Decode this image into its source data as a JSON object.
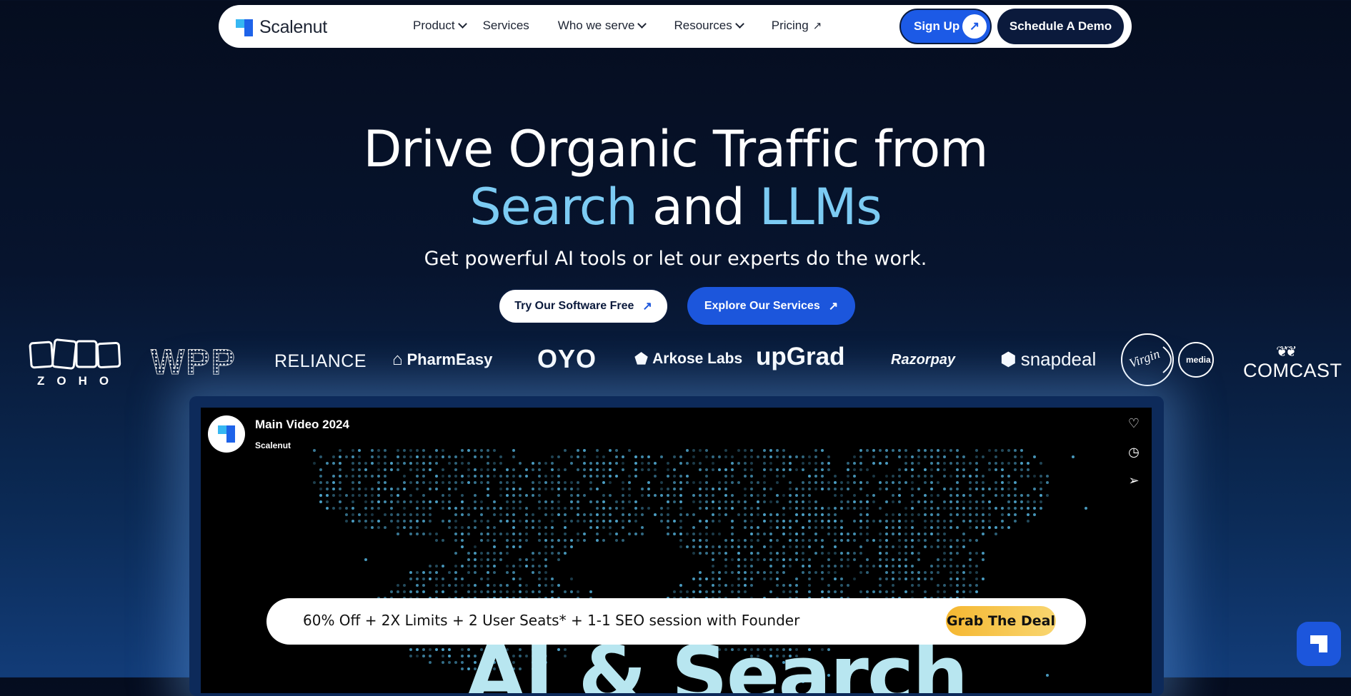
{
  "nav": {
    "logo_text": "Scalenut",
    "items": [
      {
        "label": "Product",
        "icon": "chevron-down"
      },
      {
        "label": "Services",
        "icon": ""
      },
      {
        "label": "Who we serve",
        "icon": "chevron-down"
      },
      {
        "label": "Resources",
        "icon": "chevron-down"
      },
      {
        "label": "Pricing",
        "icon": "arrow-up-right"
      }
    ],
    "signup_label": "Sign Up",
    "demo_label": "Schedule A Demo"
  },
  "hero": {
    "line1": "Drive Organic Traffic from",
    "line2_a": "Search",
    "line2_b": " and ",
    "line2_c": "LLMs",
    "subtitle": "Get powerful AI tools or let our experts do the work.",
    "cta_primary": "Try Our Software Free",
    "cta_secondary": "Explore Our Services",
    "accent_color": "#7ccbf3"
  },
  "brands": [
    "ZOHO",
    "WPP",
    "RELIANCE",
    "PharmEasy",
    "OYO",
    "Arkose Labs",
    "upGrad",
    "Razorpay",
    "snapdeal",
    "Virgin media",
    "COMCAST"
  ],
  "video": {
    "title": "Main Video 2024",
    "channel": "Scalenut",
    "overlay_text": "AI & Search",
    "icons": [
      "heart-icon",
      "clock-icon",
      "send-icon"
    ]
  },
  "promo": {
    "text": "60% Off + 2X Limits + 2 User Seats* + 1-1 SEO session with Founder",
    "button": "Grab The Deal",
    "button_color": "#f5b731"
  },
  "colors": {
    "primary_blue": "#1c56dc",
    "navy": "#0b1a3c"
  }
}
